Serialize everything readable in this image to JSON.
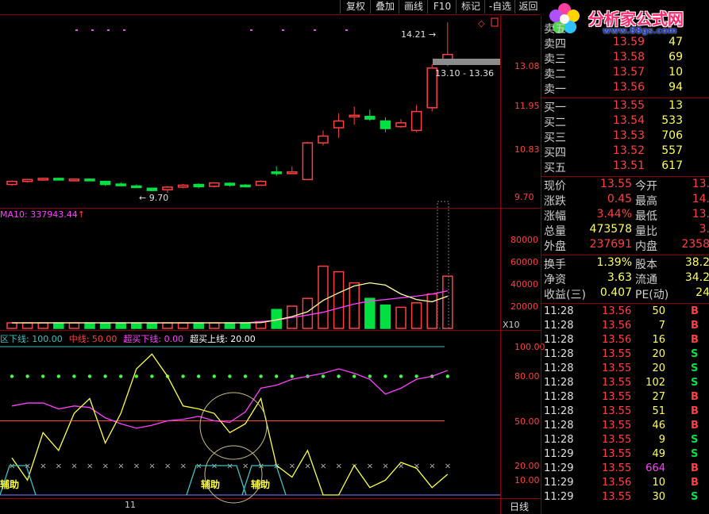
{
  "toolbar": [
    "复权",
    "叠加",
    "画线",
    "F10",
    "标记",
    "-自选",
    "返回"
  ],
  "logo": {
    "name": "分析家公式网",
    "url": "www.88gs.com"
  },
  "price_axis": [
    "13.08",
    "11.95",
    "10.83",
    "9.70"
  ],
  "volume_axis": [
    "80000",
    "60000",
    "40000",
    "20000"
  ],
  "indicator_axis": [
    "100.00",
    "80.00",
    "50.00",
    "20.00",
    "10.00"
  ],
  "main_labels": {
    "high": "14.21",
    "low": "9.70",
    "range": "13.10 - 13.36"
  },
  "volume_header": "MA10: 337943.44",
  "volume_unit": "X10",
  "indicator_header": [
    {
      "text": "区下线: 100.00",
      "color": "#40c0c0"
    },
    {
      "text": "中线: 50.00",
      "color": "#ff4040"
    },
    {
      "text": "超买下线: 0.00",
      "color": "#ff40ff"
    },
    {
      "text": "超买上线: 20.00",
      "color": "#ffffff"
    }
  ],
  "indicator_marks": [
    "辅助",
    "辅助",
    "辅助"
  ],
  "x_axis_label": "11",
  "period_button": "日线",
  "order_book": {
    "sell": [
      {
        "label": "卖五",
        "price": "",
        "volume": ""
      },
      {
        "label": "卖四",
        "price": "13.59",
        "volume": "47"
      },
      {
        "label": "卖三",
        "price": "13.58",
        "volume": "69"
      },
      {
        "label": "卖二",
        "price": "13.57",
        "volume": "10"
      },
      {
        "label": "卖一",
        "price": "13.56",
        "volume": "94"
      }
    ],
    "buy": [
      {
        "label": "买一",
        "price": "13.55",
        "volume": "13"
      },
      {
        "label": "买二",
        "price": "13.54",
        "volume": "533"
      },
      {
        "label": "买三",
        "price": "13.53",
        "volume": "706"
      },
      {
        "label": "买四",
        "price": "13.52",
        "volume": "557"
      },
      {
        "label": "买五",
        "price": "13.51",
        "volume": "617"
      }
    ]
  },
  "stats": [
    {
      "l1": "现价",
      "v1": "13.55",
      "c1": "#ff4040",
      "l2": "今开",
      "v2": "13."
    },
    {
      "l1": "涨跌",
      "v1": "0.45",
      "c1": "#ff4040",
      "l2": "最高",
      "v2": "14."
    },
    {
      "l1": "涨幅",
      "v1": "3.44%",
      "c1": "#ff4040",
      "l2": "最低",
      "v2": "13."
    },
    {
      "l1": "总量",
      "v1": "473578",
      "c1": "#ffff55",
      "l2": "量比",
      "v2": "3."
    },
    {
      "l1": "外盘",
      "v1": "237691",
      "c1": "#ff4040",
      "l2": "内盘",
      "v2": "2358"
    }
  ],
  "stats2": [
    {
      "l1": "换手",
      "v1": "1.39%",
      "l2": "股本",
      "v2": "38.2"
    },
    {
      "l1": "净资",
      "v1": "3.63",
      "l2": "流通",
      "v2": "34.2"
    },
    {
      "l1": "收益(三)",
      "v1": "0.407",
      "l2": "PE(动)",
      "v2": "24"
    }
  ],
  "ticks": [
    {
      "t": "11:28",
      "p": "13.56",
      "v": "50",
      "d": "B"
    },
    {
      "t": "11:28",
      "p": "13.56",
      "v": "7",
      "d": "B"
    },
    {
      "t": "11:28",
      "p": "13.56",
      "v": "16",
      "d": "B"
    },
    {
      "t": "11:28",
      "p": "13.55",
      "v": "20",
      "d": "S"
    },
    {
      "t": "11:28",
      "p": "13.55",
      "v": "20",
      "d": "S"
    },
    {
      "t": "11:28",
      "p": "13.55",
      "v": "102",
      "d": "S"
    },
    {
      "t": "11:28",
      "p": "13.55",
      "v": "27",
      "d": "B"
    },
    {
      "t": "11:28",
      "p": "13.55",
      "v": "51",
      "d": "B"
    },
    {
      "t": "11:28",
      "p": "13.55",
      "v": "46",
      "d": "B"
    },
    {
      "t": "11:28",
      "p": "13.55",
      "v": "9",
      "d": "S"
    },
    {
      "t": "11:29",
      "p": "13.55",
      "v": "49",
      "d": "S"
    },
    {
      "t": "11:29",
      "p": "13.55",
      "v": "664",
      "d": "B"
    },
    {
      "t": "11:29",
      "p": "13.56",
      "v": "10",
      "d": "B"
    },
    {
      "t": "11:29",
      "p": "13.55",
      "v": "30",
      "d": "S"
    }
  ],
  "chart_data": {
    "type": "candlestick",
    "candles": [
      {
        "o": 9.92,
        "c": 10.0,
        "h": 10.03,
        "l": 9.88
      },
      {
        "o": 10.0,
        "c": 10.05,
        "h": 10.07,
        "l": 9.97
      },
      {
        "o": 10.05,
        "c": 10.08,
        "h": 10.1,
        "l": 10.02
      },
      {
        "o": 10.08,
        "c": 10.05,
        "h": 10.1,
        "l": 10.03
      },
      {
        "o": 10.03,
        "c": 10.06,
        "h": 10.08,
        "l": 10.0
      },
      {
        "o": 10.06,
        "c": 10.03,
        "h": 10.08,
        "l": 10.01
      },
      {
        "o": 10.0,
        "c": 9.92,
        "h": 10.02,
        "l": 9.88
      },
      {
        "o": 9.93,
        "c": 9.9,
        "h": 9.98,
        "l": 9.86
      },
      {
        "o": 9.88,
        "c": 9.86,
        "h": 9.92,
        "l": 9.84
      },
      {
        "o": 9.82,
        "c": 9.76,
        "h": 9.84,
        "l": 9.74
      },
      {
        "o": 9.78,
        "c": 9.85,
        "h": 9.88,
        "l": 9.7
      },
      {
        "o": 9.85,
        "c": 9.9,
        "h": 9.93,
        "l": 9.82
      },
      {
        "o": 9.92,
        "c": 9.86,
        "h": 9.95,
        "l": 9.82
      },
      {
        "o": 9.87,
        "c": 9.96,
        "h": 9.98,
        "l": 9.84
      },
      {
        "o": 9.95,
        "c": 9.9,
        "h": 9.98,
        "l": 9.86
      },
      {
        "o": 9.9,
        "c": 9.88,
        "h": 9.93,
        "l": 9.85
      },
      {
        "o": 9.9,
        "c": 10.0,
        "h": 10.03,
        "l": 9.88
      },
      {
        "o": 10.25,
        "c": 10.22,
        "h": 10.4,
        "l": 10.15
      },
      {
        "o": 10.25,
        "c": 10.25,
        "h": 10.4,
        "l": 10.2
      },
      {
        "o": 10.05,
        "c": 11.02,
        "h": 11.05,
        "l": 10.03
      },
      {
        "o": 11.02,
        "c": 11.2,
        "h": 11.35,
        "l": 10.95
      },
      {
        "o": 11.42,
        "c": 11.6,
        "h": 11.8,
        "l": 11.15
      },
      {
        "o": 11.72,
        "c": 11.75,
        "h": 11.98,
        "l": 11.5
      },
      {
        "o": 11.72,
        "c": 11.65,
        "h": 11.9,
        "l": 11.6
      },
      {
        "o": 11.6,
        "c": 11.4,
        "h": 11.7,
        "l": 11.3
      },
      {
        "o": 11.45,
        "c": 11.55,
        "h": 11.65,
        "l": 11.42
      },
      {
        "o": 11.35,
        "c": 11.85,
        "h": 12.02,
        "l": 11.3
      },
      {
        "o": 11.95,
        "c": 13.0,
        "h": 13.1,
        "l": 11.85
      },
      {
        "o": 13.1,
        "c": 13.36,
        "h": 14.21,
        "l": 13.05
      }
    ],
    "volume": [
      5000,
      5000,
      5000,
      5000,
      5000,
      5000,
      5000,
      5000,
      5000,
      5000,
      5000,
      5000,
      5000,
      5000,
      5000,
      5000,
      6000,
      17000,
      20000,
      27000,
      56000,
      51000,
      41000,
      27000,
      21000,
      19000,
      23000,
      31000,
      47000
    ],
    "volume_ma10": [
      5000,
      5000,
      5000,
      5000,
      5000,
      5000,
      5000,
      5000,
      5000,
      5000,
      5000,
      5000,
      5000,
      5000,
      5000,
      5000,
      6100,
      7300,
      9800,
      12000,
      14500,
      18300,
      22000,
      24500,
      26000,
      27500,
      29000,
      31000,
      33794
    ],
    "volume_ma5": [
      5000,
      5000,
      5000,
      5000,
      5000,
      5000,
      5000,
      5000,
      5000,
      5000,
      5000,
      5000,
      5000,
      5000,
      5000,
      5000,
      5200,
      7600,
      10600,
      15000,
      25200,
      32000,
      38200,
      41000,
      39000,
      31000,
      26000,
      24000,
      29000
    ],
    "ind_yellow": [
      25,
      10,
      42,
      30,
      55,
      65,
      35,
      55,
      85,
      95,
      80,
      60,
      58,
      55,
      42,
      48,
      65,
      20,
      12,
      30,
      0,
      0,
      20,
      5,
      10,
      22,
      18,
      5,
      14
    ],
    "ind_magenta": [
      60,
      62,
      62,
      58,
      60,
      59,
      52,
      48,
      45,
      47,
      50,
      51,
      53,
      50,
      49,
      56,
      72,
      74,
      78,
      80,
      82,
      85,
      82,
      78,
      68,
      72,
      78,
      80,
      84
    ]
  }
}
